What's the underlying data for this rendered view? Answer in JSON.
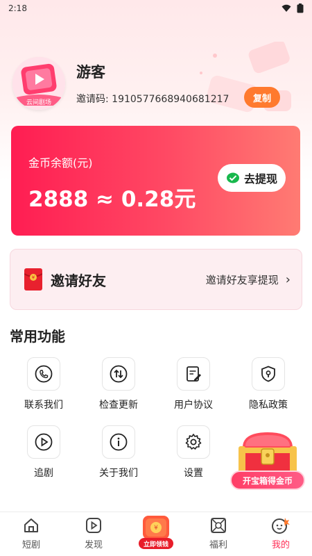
{
  "status_bar": {
    "time": "2:18"
  },
  "profile": {
    "username": "游客",
    "invite_label": "邀请码:",
    "invite_code": "1910577668940681217",
    "copy_label": "复制",
    "avatar_text": "云间剧场"
  },
  "coin_card": {
    "label": "金币余额(元)",
    "value": "2888 ≈ 0.28元",
    "withdraw_label": "去提现"
  },
  "invite": {
    "title": "邀请好友",
    "subtitle": "邀请好友享提现"
  },
  "features": {
    "title": "常用功能",
    "items": [
      {
        "label": "联系我们",
        "icon": "phone-icon"
      },
      {
        "label": "检查更新",
        "icon": "update-icon"
      },
      {
        "label": "用户协议",
        "icon": "agreement-icon"
      },
      {
        "label": "隐私政策",
        "icon": "privacy-icon"
      },
      {
        "label": "追剧",
        "icon": "play-icon"
      },
      {
        "label": "关于我们",
        "icon": "info-icon"
      },
      {
        "label": "设置",
        "icon": "gear-icon"
      }
    ]
  },
  "treasure": {
    "label": "开宝箱得金币"
  },
  "bottom_nav": {
    "items": [
      {
        "label": "短剧",
        "icon": "home-icon"
      },
      {
        "label": "发现",
        "icon": "discover-icon"
      },
      {
        "label": "立即领钱",
        "icon": "claim-icon"
      },
      {
        "label": "福利",
        "icon": "welfare-icon"
      },
      {
        "label": "我的",
        "icon": "me-icon"
      }
    ],
    "active_index": 4
  },
  "colors": {
    "primary": "#ff2d55",
    "copy_button": "#ff7a2e"
  }
}
